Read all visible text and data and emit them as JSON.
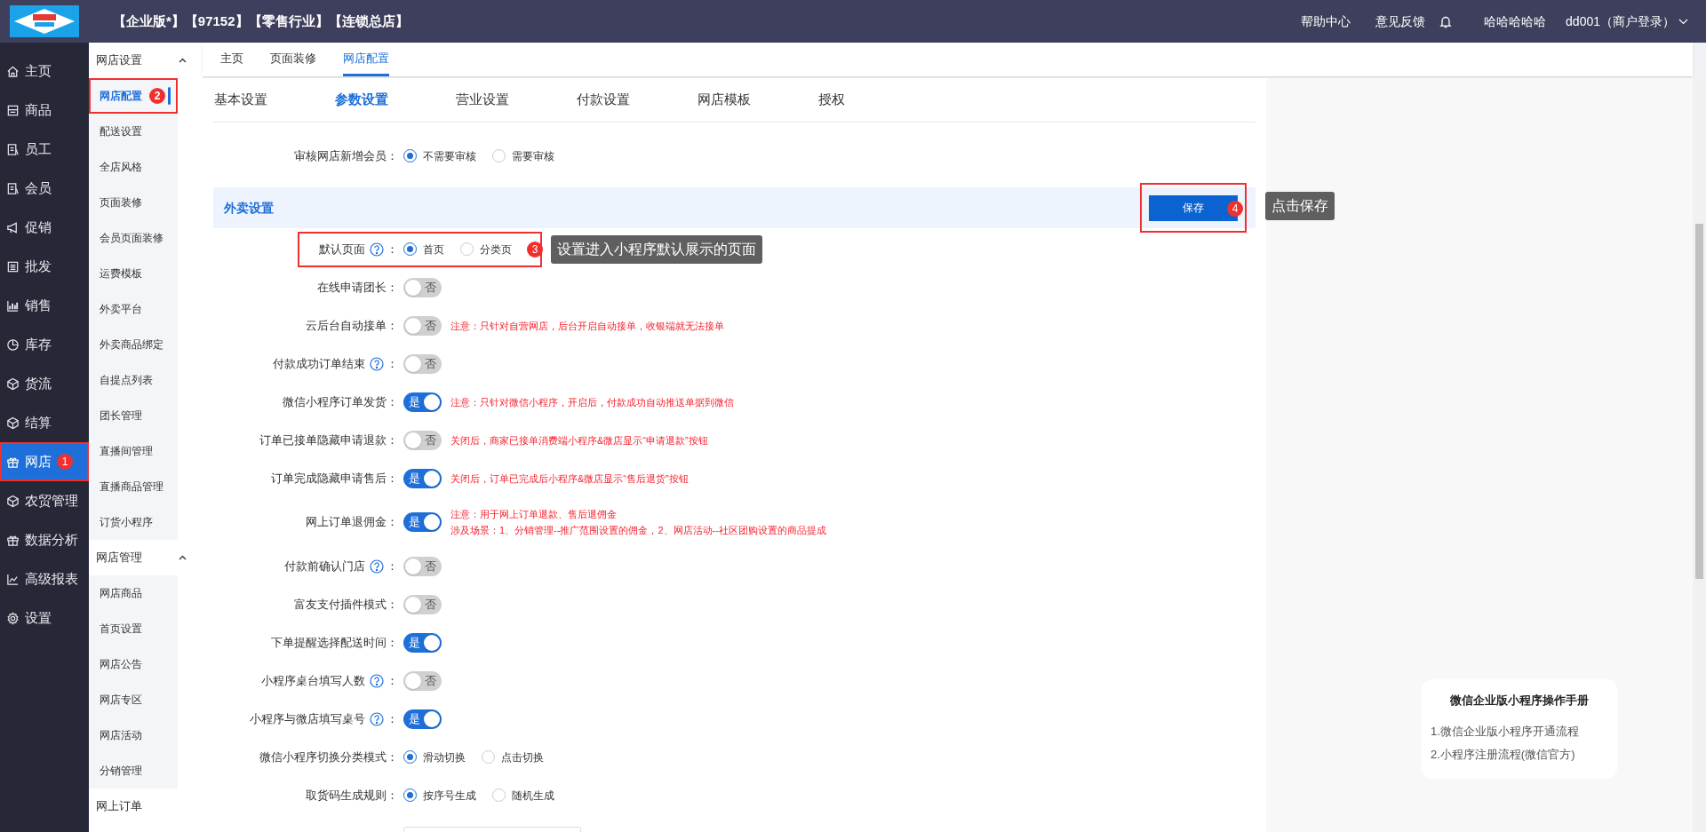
{
  "header": {
    "brand": "【企业版*】【97152】【零售行业】【连锁总店】",
    "links": [
      "帮助中心",
      "意见反馈"
    ],
    "user_name": "哈哈哈哈哈",
    "account": "dd001（商户登录）"
  },
  "nav": [
    {
      "label": "主页",
      "selected": false
    },
    {
      "label": "商品",
      "selected": false
    },
    {
      "label": "员工",
      "selected": false
    },
    {
      "label": "会员",
      "selected": false
    },
    {
      "label": "促销",
      "selected": false
    },
    {
      "label": "批发",
      "selected": false
    },
    {
      "label": "销售",
      "selected": false
    },
    {
      "label": "库存",
      "selected": false
    },
    {
      "label": "货流",
      "selected": false
    },
    {
      "label": "结算",
      "selected": false
    },
    {
      "label": "网店",
      "selected": true,
      "callout": "1"
    },
    {
      "label": "农贸管理",
      "selected": false
    },
    {
      "label": "数据分析",
      "selected": false
    },
    {
      "label": "高级报表",
      "selected": false
    },
    {
      "label": "设置",
      "selected": false
    }
  ],
  "subnav": [
    {
      "title": "网店设置",
      "expanded": true,
      "items": [
        {
          "label": "网店配置",
          "selected": true,
          "callout": "2"
        },
        {
          "label": "配送设置",
          "selected": false
        },
        {
          "label": "全店风格",
          "selected": false
        },
        {
          "label": "页面装修",
          "selected": false
        },
        {
          "label": "会员页面装修",
          "selected": false
        },
        {
          "label": "运费模板",
          "selected": false
        },
        {
          "label": "外卖平台",
          "selected": false
        },
        {
          "label": "外卖商品绑定",
          "selected": false
        },
        {
          "label": "自提点列表",
          "selected": false
        },
        {
          "label": "团长管理",
          "selected": false
        },
        {
          "label": "直播间管理",
          "selected": false
        },
        {
          "label": "直播商品管理",
          "selected": false
        },
        {
          "label": "订货小程序",
          "selected": false
        }
      ]
    },
    {
      "title": "网店管理",
      "expanded": true,
      "items": [
        {
          "label": "网店商品",
          "selected": false
        },
        {
          "label": "首页设置",
          "selected": false
        },
        {
          "label": "网店公告",
          "selected": false
        },
        {
          "label": "网店专区",
          "selected": false
        },
        {
          "label": "网店活动",
          "selected": false
        },
        {
          "label": "分销管理",
          "selected": false
        }
      ]
    },
    {
      "title": "网上订单",
      "expanded": false
    }
  ],
  "page_tabs": [
    {
      "label": "主页",
      "selected": false
    },
    {
      "label": "页面装修",
      "selected": false
    },
    {
      "label": "网店配置",
      "selected": true
    }
  ],
  "settings_tabs": [
    {
      "label": "基本设置",
      "selected": false
    },
    {
      "label": "参数设置",
      "selected": true
    },
    {
      "label": "营业设置",
      "selected": false
    },
    {
      "label": "付款设置",
      "selected": false
    },
    {
      "label": "网店模板",
      "selected": false
    },
    {
      "label": "授权",
      "selected": false
    }
  ],
  "rows": [
    {
      "kind": "radio",
      "label": "审核网店新增会员：",
      "help": false,
      "options": [
        {
          "label": "不需要审核",
          "selected": true
        },
        {
          "label": "需要审核",
          "selected": false
        }
      ]
    },
    {
      "kind": "section",
      "title": "外卖设置",
      "button": "保存",
      "callout": "4",
      "tooltip": "点击保存"
    },
    {
      "kind": "radio",
      "label": "默认页面",
      "help": true,
      "colon": "：",
      "options": [
        {
          "label": "首页",
          "selected": true
        },
        {
          "label": "分类页",
          "selected": false
        }
      ],
      "callout": "3",
      "tooltip": "设置进入小程序默认展示的页面"
    },
    {
      "kind": "toggle",
      "label": "在线申请团长：",
      "help": false,
      "on": false,
      "text": "否"
    },
    {
      "kind": "toggle",
      "label": "云后台自动接单：",
      "help": false,
      "on": false,
      "text": "否",
      "notes": [
        "注意：只针对自营网店，后台开启自动接单，收银端就无法接单"
      ]
    },
    {
      "kind": "toggle",
      "label": "付款成功订单结束",
      "help": true,
      "colon": "：",
      "on": false,
      "text": "否"
    },
    {
      "kind": "toggle",
      "label": "微信小程序订单发货：",
      "help": false,
      "on": true,
      "text": "是",
      "notes": [
        "注意：只针对微信小程序，开启后，付款成功自动推送单据到微信"
      ]
    },
    {
      "kind": "toggle",
      "label": "订单已接单隐藏申请退款：",
      "help": false,
      "on": false,
      "text": "否",
      "notes": [
        "关闭后，商家已接单消费端小程序&微店显示“申请退款”按钮"
      ]
    },
    {
      "kind": "toggle",
      "label": "订单完成隐藏申请售后：",
      "help": false,
      "on": true,
      "text": "是",
      "notes": [
        "关闭后，订单已完成后小程序&微店显示“售后退货”按钮"
      ]
    },
    {
      "kind": "toggle",
      "label": "网上订单退佣金：",
      "help": false,
      "on": true,
      "text": "是",
      "notes": [
        "注意：用于网上订单退款、售后退佣金",
        "涉及场景：1、分销管理--推广范围设置的佣金，2、网店活动--社区团购设置的商品提成"
      ]
    },
    {
      "kind": "toggle",
      "label": "付款前确认门店",
      "help": true,
      "colon": "：",
      "on": false,
      "text": "否"
    },
    {
      "kind": "toggle",
      "label": "富友支付插件模式：",
      "help": false,
      "on": false,
      "text": "否"
    },
    {
      "kind": "toggle",
      "label": "下单提醒选择配送时间：",
      "help": false,
      "on": true,
      "text": "是"
    },
    {
      "kind": "toggle",
      "label": "小程序桌台填写人数",
      "help": true,
      "colon": "：",
      "on": false,
      "text": "否"
    },
    {
      "kind": "toggle",
      "label": "小程序与微店填写桌号",
      "help": true,
      "colon": "：",
      "on": true,
      "text": "是"
    },
    {
      "kind": "radio",
      "label": "微信小程序切换分类模式：",
      "help": false,
      "options": [
        {
          "label": "滑动切换",
          "selected": true
        },
        {
          "label": "点击切换",
          "selected": false
        }
      ]
    },
    {
      "kind": "radio",
      "label": "取货码生成规则：",
      "help": false,
      "options": [
        {
          "label": "按序号生成",
          "selected": true
        },
        {
          "label": "随机生成",
          "selected": false
        }
      ]
    },
    {
      "kind": "field"
    }
  ],
  "manual": {
    "title": "微信企业版小程序操作手册",
    "links": [
      "1.微信企业版小程序开通流程",
      "2.小程序注册流程(微信官方)"
    ]
  }
}
